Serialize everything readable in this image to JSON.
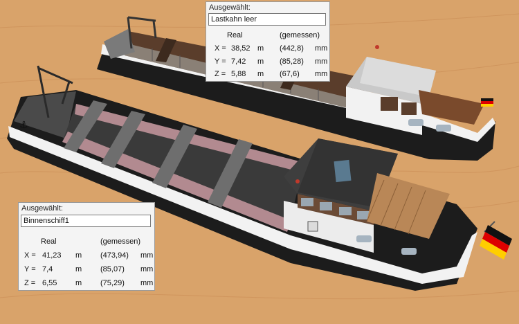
{
  "panels": [
    {
      "caption": "Ausgewählt:",
      "name": "Lastkahn leer",
      "col_real": "Real",
      "col_measured": "(gemessen)",
      "rows": [
        {
          "axis": "X =",
          "real": "38,52",
          "unit": "m",
          "measured": "(442,8)",
          "unit2": "mm"
        },
        {
          "axis": "Y =",
          "real": "7,42",
          "unit": "m",
          "measured": "(85,28)",
          "unit2": "mm"
        },
        {
          "axis": "Z =",
          "real": "5,88",
          "unit": "m",
          "measured": "(67,6)",
          "unit2": "mm"
        }
      ]
    },
    {
      "caption": "Ausgewählt:",
      "name": "Binnenschiff1",
      "col_real": "Real",
      "col_measured": "(gemessen)",
      "rows": [
        {
          "axis": "X =",
          "real": "41,23",
          "unit": "m",
          "measured": "(473,94)",
          "unit2": "mm"
        },
        {
          "axis": "Y =",
          "real": "7,4",
          "unit": "m",
          "measured": "(85,07)",
          "unit2": "mm"
        },
        {
          "axis": "Z =",
          "real": "6,55",
          "unit": "m",
          "measured": "(75,29)",
          "unit2": "mm"
        }
      ]
    }
  ],
  "colors": {
    "wood": "#d9a36a",
    "hull": "#1c1c1c",
    "deck": "#3a3a3a",
    "flag_black": "#111111",
    "flag_red": "#dd0000",
    "flag_gold": "#ffce00"
  }
}
